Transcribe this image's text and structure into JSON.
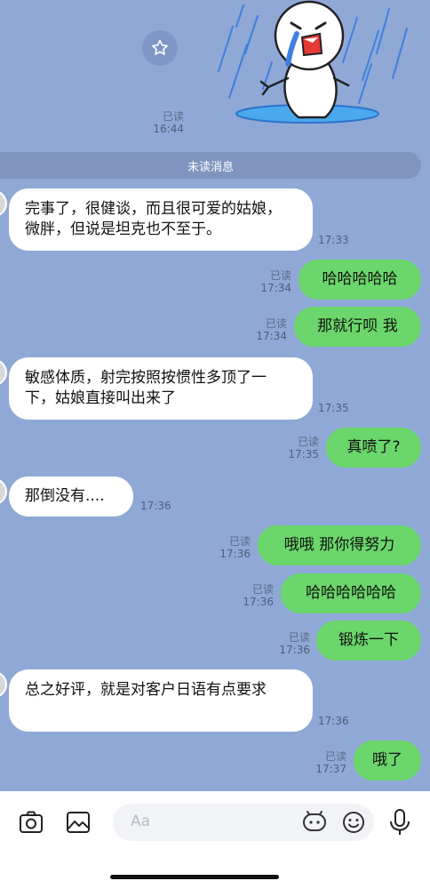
{
  "chat": {
    "top_read": {
      "status": "已读",
      "time": "16:44"
    },
    "divider_label": "未读消息",
    "messages": [
      {
        "side": "left",
        "text": "完事了，很健谈，而且很可爱的姑娘，微胖，但说是坦克也不至于。",
        "time": "17:33"
      },
      {
        "side": "right",
        "text": "哈哈哈哈哈",
        "status": "已读",
        "time": "17:34"
      },
      {
        "side": "right",
        "text": "那就行呗 我",
        "status": "已读",
        "time": "17:34"
      },
      {
        "side": "left",
        "text": "敏感体质，射完按照按惯性多顶了一下，姑娘直接叫出来了",
        "time": "17:35"
      },
      {
        "side": "right",
        "text": "真喷了?",
        "status": "已读",
        "time": "17:35"
      },
      {
        "side": "left",
        "text": "那倒没有....",
        "time": "17:36"
      },
      {
        "side": "right",
        "text": "哦哦 那你得努力",
        "status": "已读",
        "time": "17:36"
      },
      {
        "side": "right",
        "text": "哈哈哈哈哈哈",
        "status": "已读",
        "time": "17:36"
      },
      {
        "side": "right",
        "text": "锻炼一下",
        "status": "已读",
        "time": "17:36"
      },
      {
        "side": "left",
        "text": "总之好评，就是对客户日语有点要求",
        "time": "17:36"
      },
      {
        "side": "right",
        "text": "哦了",
        "status": "已读",
        "time": "17:37"
      }
    ]
  },
  "input": {
    "placeholder": "Aa"
  },
  "icons": {
    "star": "star-icon",
    "camera": "camera-icon",
    "gallery": "image-icon",
    "sticker": "sticker-icon",
    "emoji": "emoji-icon",
    "mic": "microphone-icon"
  },
  "colors": {
    "background": "#8fa8d6",
    "outgoing": "#6bd66b",
    "incoming": "#ffffff"
  }
}
